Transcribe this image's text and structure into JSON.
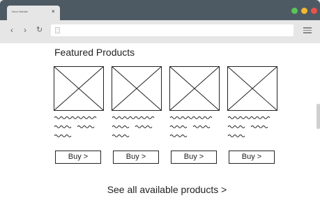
{
  "browser": {
    "tab_title": "Demo Website",
    "tab_close": "×",
    "nav_back": "‹",
    "nav_forward": "›",
    "nav_reload": "↻"
  },
  "page": {
    "heading": "Featured Products",
    "products": [
      {
        "buy_label": "Buy >"
      },
      {
        "buy_label": "Buy >"
      },
      {
        "buy_label": "Buy >"
      },
      {
        "buy_label": "Buy >"
      }
    ],
    "see_all": "See all available products >"
  },
  "colors": {
    "titlebar": "#4e5a63",
    "toolbar": "#e6e6e6",
    "dot_green": "#5cc45a",
    "dot_yellow": "#f2b733",
    "dot_red": "#e8514d"
  }
}
